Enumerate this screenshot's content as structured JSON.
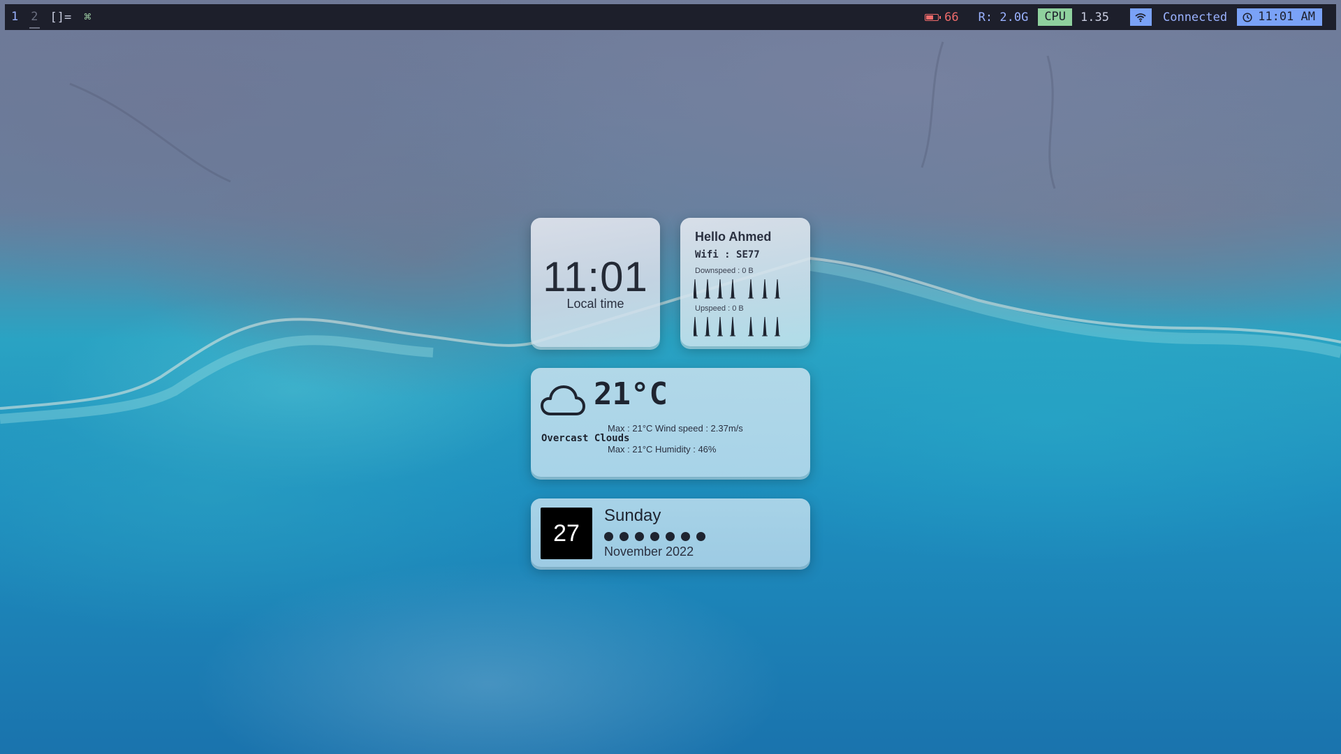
{
  "bar": {
    "workspaces": [
      "1",
      "2"
    ],
    "layout": "[]=",
    "cmd_symbol": "⌘",
    "battery": {
      "icon": "battery-icon",
      "value": "66",
      "level": 0.66,
      "color": "#ef6b6b"
    },
    "ram": "R: 2.0G",
    "cpu": {
      "label": "CPU",
      "value": "1.35",
      "color": "#8fd19e"
    },
    "wifi": {
      "icon": "wifi-icon",
      "status": "Connected",
      "color": "#7aa2f7"
    },
    "clock": {
      "icon": "clock-icon",
      "time": "11:01 AM"
    }
  },
  "clock_widget": {
    "time": "11:01",
    "label": "Local time"
  },
  "net_widget": {
    "greeting": "Hello Ahmed",
    "wifi_label": "Wifi :",
    "wifi_ssid": "SE77",
    "down_label": "Downspeed : 0 B",
    "up_label": "Upspeed : 0 B"
  },
  "weather_widget": {
    "icon": "cloud-icon",
    "temp": "21°C",
    "line1": "Max : 21°C Wind speed : 2.37m/s",
    "condition": "Overcast Clouds",
    "line2": "Max : 21°C Humidity : 46%"
  },
  "date_widget": {
    "day": "27",
    "weekday": "Sunday",
    "dots": 7,
    "month_year": "November 2022"
  }
}
